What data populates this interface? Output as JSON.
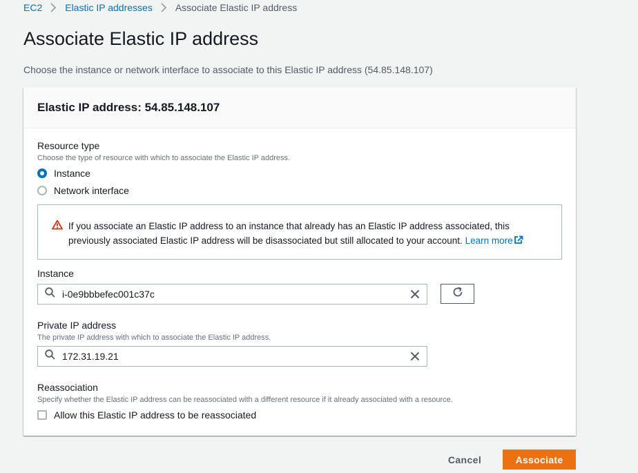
{
  "breadcrumb": {
    "items": [
      "EC2",
      "Elastic IP addresses"
    ],
    "current": "Associate Elastic IP address"
  },
  "page": {
    "title": "Associate Elastic IP address",
    "description": "Choose the instance or network interface to associate to this Elastic IP address (54.85.148.107)"
  },
  "panel": {
    "title": "Elastic IP address: 54.85.148.107"
  },
  "resource_type": {
    "label": "Resource type",
    "description": "Choose the type of resource with which to associate the Elastic IP address.",
    "options": [
      {
        "label": "Instance",
        "selected": true
      },
      {
        "label": "Network interface",
        "selected": false
      }
    ]
  },
  "alert": {
    "text": "If you associate an Elastic IP address to an instance that already has an Elastic IP address associated, this previously associated Elastic IP address will be disassociated but still allocated to your account.",
    "link": "Learn more",
    "icon": "warning-icon",
    "color": "#d13212"
  },
  "instance": {
    "label": "Instance",
    "value": "i-0e9bbbefec001c37c"
  },
  "private_ip": {
    "label": "Private IP address",
    "description": "The private IP address with which to associate the Elastic IP address.",
    "value": "172.31.19.21"
  },
  "reassociation": {
    "label": "Reassociation",
    "description": "Specify whether the Elastic IP address can be reassociated with a different resource if it already associated with a resource.",
    "checkbox_label": "Allow this Elastic IP address to be reassociated",
    "checked": false
  },
  "actions": {
    "cancel": "Cancel",
    "submit": "Associate",
    "submit_color": "#ec7211"
  }
}
